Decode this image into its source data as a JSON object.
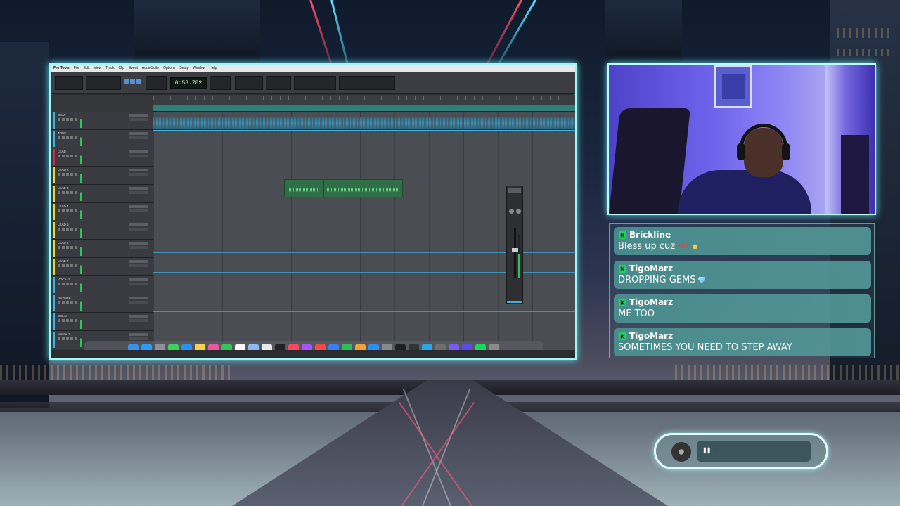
{
  "daw": {
    "app_name": "Pro Tools",
    "menus": [
      "File",
      "Edit",
      "View",
      "Track",
      "Clip",
      "Event",
      "AudioSuite",
      "Options",
      "Setup",
      "Window",
      "Help"
    ],
    "counter": "0:58.782",
    "tracks": [
      {
        "name": "BEAT",
        "color": "#3ab2e4"
      },
      {
        "name": "TONE",
        "color": "#3ab2e4"
      },
      {
        "name": "LEAD",
        "color": "#d62b45"
      },
      {
        "name": "LEAD 2",
        "color": "#e3d935"
      },
      {
        "name": "LEAD 3",
        "color": "#e3d935"
      },
      {
        "name": "LEAD 4",
        "color": "#e3d935"
      },
      {
        "name": "LEAD 5",
        "color": "#e3d935"
      },
      {
        "name": "LEAD 6",
        "color": "#e3d935"
      },
      {
        "name": "LEAD 7",
        "color": "#e3d935"
      },
      {
        "name": "VOCALS",
        "color": "#3ab2e4"
      },
      {
        "name": "REVERB",
        "color": "#3ab2e4"
      },
      {
        "name": "DELAY",
        "color": "#3ab2e4"
      },
      {
        "name": "Master 1",
        "color": "#3ab2e4"
      }
    ],
    "dock_icons": [
      "finder-icon",
      "safari-icon",
      "launchpad-icon",
      "messages-icon",
      "mail-icon",
      "notes-icon",
      "photos-icon",
      "facetime-icon",
      "calendar-icon",
      "files-icon",
      "reminders-icon",
      "appletv-icon",
      "music-icon",
      "podcasts-icon",
      "news-icon",
      "keynote-icon",
      "numbers-icon",
      "pages-icon",
      "appstore-icon",
      "settings-icon",
      "terminal-icon",
      "plugin-icon",
      "cortana-icon",
      "activity-icon",
      "audio-icon",
      "protools-icon",
      "spotify-icon",
      "trash-icon"
    ]
  },
  "chat": {
    "messages": [
      {
        "user": "Brickline",
        "text": "Bless up cuz"
      },
      {
        "user": "TigoMarz",
        "text": "DROPPING GEMS"
      },
      {
        "user": "TigoMarz",
        "text": "ME TOO"
      },
      {
        "user": "TigoMarz",
        "text": "SOMETIMES YOU NEED TO STEP AWAY"
      }
    ]
  },
  "player": {
    "state_icon": "pause-icon",
    "track_title": "-"
  },
  "colors": {
    "frame_glow": "#9ff6f4",
    "chat_bubble": "#4b9191",
    "kick_badge": "#23d160"
  }
}
